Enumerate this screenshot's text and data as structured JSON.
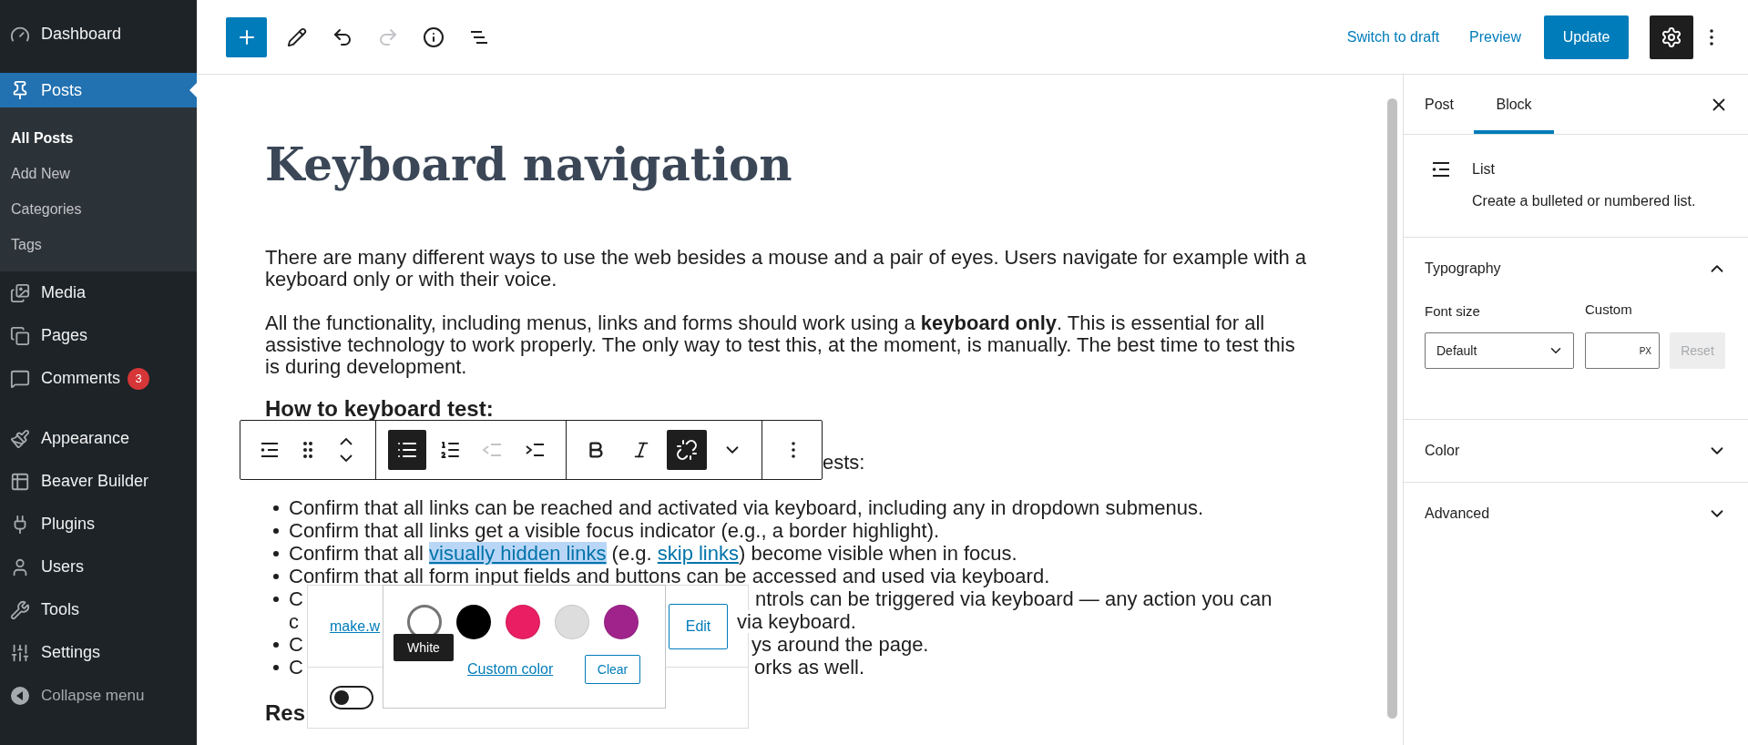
{
  "sidebar": {
    "groups": [
      [
        {
          "label": "Dashboard",
          "selected": false
        }
      ],
      [
        {
          "label": "Posts",
          "selected": true,
          "children": [
            {
              "label": "All Posts",
              "selected": true
            },
            {
              "label": "Add New",
              "selected": false
            },
            {
              "label": "Categories",
              "selected": false
            },
            {
              "label": "Tags",
              "selected": false
            }
          ]
        },
        {
          "label": "Media",
          "selected": false
        },
        {
          "label": "Pages",
          "selected": false
        },
        {
          "label": "Comments",
          "selected": false,
          "badge": "3"
        }
      ],
      [
        {
          "label": "Appearance",
          "selected": false
        },
        {
          "label": "Beaver Builder",
          "selected": false
        },
        {
          "label": "Plugins",
          "selected": false
        },
        {
          "label": "Users",
          "selected": false
        },
        {
          "label": "Tools",
          "selected": false
        },
        {
          "label": "Settings",
          "selected": false
        }
      ]
    ],
    "collapse": "Collapse menu"
  },
  "top_toolbar": {
    "tools": [
      {
        "kind": "add",
        "disabled": false
      },
      {
        "kind": "edit",
        "disabled": false
      },
      {
        "kind": "undo",
        "disabled": false
      },
      {
        "kind": "redo",
        "disabled": true
      },
      {
        "kind": "info",
        "disabled": false
      },
      {
        "kind": "outline",
        "disabled": false
      }
    ],
    "switch_to_draft": "Switch to draft",
    "preview": "Preview",
    "update": "Update",
    "settings_active": true
  },
  "editor": {
    "title": "Keyboard navigation",
    "paragraphs": [
      "There are many different ways to use the web besides a mouse and a pair of eyes.  Users navigate for example with a keyboard only or with their voice.",
      "All the functionality, including menus, links and forms should work using a **keyboard only**. This is essential for all assistive technology to work properly. The only way to test this, at the moment, is manually. The best time to test this is during development."
    ],
    "heading": "How to keyboard test:",
    "intro_fragment": "ests:",
    "list": [
      {
        "kind": "text",
        "parts": [
          {
            "text": "Confirm that all links can be reached and activated via keyboard, including any in dropdown submenus."
          }
        ]
      },
      {
        "kind": "text",
        "parts": [
          {
            "text": "Confirm that all links get a visible focus indicator (e.g., a border highlight)."
          }
        ]
      },
      {
        "kind": "text",
        "parts": [
          {
            "text": "Confirm that all "
          },
          {
            "text": "visually hidden links",
            "link": true,
            "highlighted": true
          },
          {
            "text": " (e.g. "
          },
          {
            "text": "skip links",
            "link": true,
            "highlighted": false
          },
          {
            "text": ") become visible when in focus."
          }
        ]
      },
      {
        "kind": "text",
        "parts": [
          {
            "text": "Confirm that all form input fields and buttons can be accessed and used via keyboard."
          }
        ]
      },
      {
        "kind": "covered",
        "lines": [
          [
            "C",
            "ntrols can be triggered via keyboard — any action you can"
          ],
          [
            "c",
            "via keyboard."
          ]
        ]
      },
      {
        "kind": "covered",
        "lines": [
          [
            "C",
            "ys around the page."
          ]
        ]
      },
      {
        "kind": "covered",
        "lines": [
          [
            "C",
            "orks as well."
          ]
        ]
      }
    ],
    "heading_2_fragment": "Res"
  },
  "block_toolbar": {
    "groups": [
      {
        "tools": [
          {
            "kind": "list-block",
            "active": false,
            "disabled": false
          },
          {
            "kind": "drag",
            "active": false,
            "disabled": false
          },
          {
            "kind": "mover",
            "active": false,
            "disabled": false
          }
        ]
      },
      {
        "tools": [
          {
            "kind": "unordered",
            "active": true,
            "disabled": false
          },
          {
            "kind": "ordered",
            "active": false,
            "disabled": false
          },
          {
            "kind": "outdent",
            "active": false,
            "disabled": true
          },
          {
            "kind": "indent",
            "active": false,
            "disabled": false
          }
        ]
      },
      {
        "tools": [
          {
            "kind": "bold",
            "active": false,
            "disabled": false
          },
          {
            "kind": "italic",
            "active": false,
            "disabled": false
          },
          {
            "kind": "unlink",
            "active": true,
            "disabled": false
          },
          {
            "kind": "more",
            "active": false,
            "disabled": false
          }
        ]
      },
      {
        "tools": [
          {
            "kind": "options",
            "active": false,
            "disabled": false
          }
        ]
      }
    ]
  },
  "link_popover": {
    "url": "make.w",
    "edit": "Edit",
    "toggle_on": false
  },
  "color_popover": {
    "swatches": [
      {
        "color": "#ffffff",
        "selected": true
      },
      {
        "color": "#000000",
        "selected": false
      },
      {
        "color": "#e91e63",
        "selected": false
      },
      {
        "color": "#dddddd",
        "selected": false
      },
      {
        "color": "#a0238c",
        "selected": false
      }
    ],
    "tooltip": "White",
    "custom": "Custom color",
    "clear": "Clear"
  },
  "right_panel": {
    "tabs": [
      {
        "label": "Post",
        "selected": false
      },
      {
        "label": "Block",
        "selected": true
      }
    ],
    "block": {
      "name": "List",
      "description": "Create a bulleted or numbered list."
    },
    "sections": [
      {
        "title": "Typography",
        "expanded": true,
        "font_size": {
          "label": "Font size",
          "value": "Default",
          "custom_label": "Custom",
          "unit": "PX",
          "reset": "Reset",
          "reset_disabled": true
        }
      },
      {
        "title": "Color",
        "expanded": false
      },
      {
        "title": "Advanced",
        "expanded": false
      }
    ]
  }
}
